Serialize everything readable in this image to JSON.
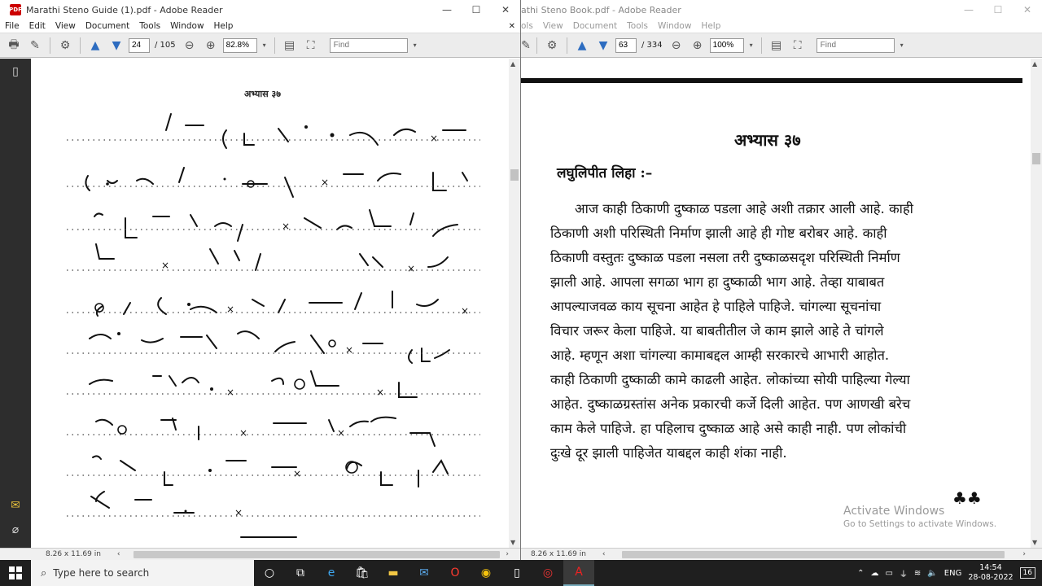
{
  "left_window": {
    "title": "Marathi Steno Guide (1).pdf - Adobe Reader",
    "menu": [
      "File",
      "Edit",
      "View",
      "Document",
      "Tools",
      "Window",
      "Help"
    ],
    "page_current": "24",
    "page_total": "/ 105",
    "zoom": "82.8%",
    "find_placeholder": "Find",
    "page_heading": "अभ्यास ३७",
    "page_size": "8.26 x 11.69 in"
  },
  "right_window": {
    "title": "athi Steno Book.pdf - Adobe Reader",
    "menu": [
      "ols",
      "View",
      "Document",
      "Tools",
      "Window",
      "Help"
    ],
    "page_current": "63",
    "page_total": "/ 334",
    "zoom": "100%",
    "find_placeholder": "Find",
    "heading": "अभ्यास ३७",
    "subheading": "लघुलिपीत लिहा :–",
    "paragraph_lines": [
      "आज काही ठिकाणी दुष्काळ पडला आहे अशी तक्रार आली आहे. काही",
      "ठिकाणी अशी परिस्थिती निर्माण झाली आहे ही गोष्ट बरोबर आहे. काही",
      "ठिकाणी वस्तुतः दुष्काळ पडला नसला तरी दुष्काळसदृश परिस्थिती निर्माण",
      "झाली आहे. आपला सगळा भाग हा दुष्काळी भाग आहे. तेव्हा याबाबत",
      "आपल्याजवळ काय सूचना आहेत हे पाहिले पाहिजे. चांगल्या सूचनांचा",
      "विचार जरूर केला पाहिजे. या बाबतीतील जे काम झाले आहे ते चांगले",
      "आहे. म्हणून अशा चांगल्या कामाबद्दल आम्ही सरकारचे आभारी आहोत.",
      "काही ठिकाणी दुष्काळी कामे काढली आहेत. लोकांच्या सोयी पाहिल्या गेल्या",
      "आहेत. दुष्काळग्रस्तांस अनेक प्रकारची कर्जे दिली आहेत. पण आणखी बरेच",
      "काम केले पाहिजे. हा पहिलाच दुष्काळ आहे असे काही नाही. पण लोकांची",
      "दुःखे दूर झाली पाहिजेत याबद्दल काही शंका नाही."
    ],
    "ornament": "♣♣",
    "watermark_title": "Activate Windows",
    "watermark_sub": "Go to Settings to activate Windows.",
    "page_size": "8.26 x 11.69 in"
  },
  "taskbar": {
    "search_placeholder": "Type here to search",
    "lang": "ENG",
    "time": "14:54",
    "date": "28-08-2022",
    "notif_count": "16"
  }
}
